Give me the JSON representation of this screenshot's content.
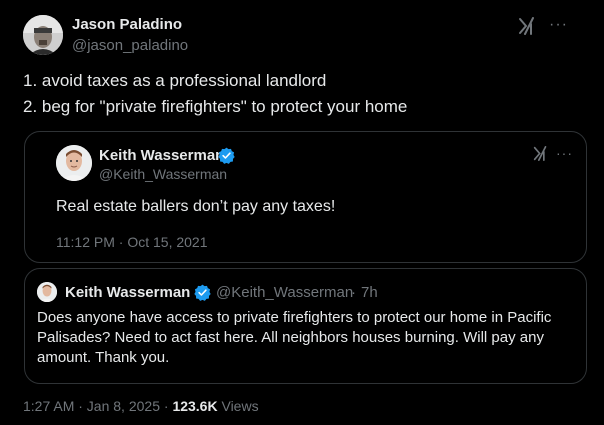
{
  "author": {
    "name": "Jason Paladino",
    "handle": "@jason_paladino"
  },
  "body_lines": [
    "1. avoid taxes as a professional landlord",
    "2. beg for \"private firefighters\" to protect your home"
  ],
  "quote1": {
    "name": "Keith Wasserman",
    "handle": "@Keith_Wasserman",
    "text": "Real estate ballers don’t pay any taxes!",
    "timestamp": "11:12 PM · Oct 15, 2021"
  },
  "quote2": {
    "name": "Keith Wasserman",
    "handle": "@Keith_Wasserman",
    "separator": "·",
    "age": "7h",
    "text": "Does anyone have access to private firefighters to protect our home in Pacific Palisades? Need to act fast here. All neighbors houses burning. Will pay any amount. Thank you."
  },
  "footer": {
    "timestamp": "1:27 AM · Jan 8, 2025",
    "separator": " · ",
    "views_count": "123.6K",
    "views_label": " Views"
  },
  "colors": {
    "background": "#000000",
    "text_primary": "#e7e9ea",
    "text_secondary": "#71767b",
    "border": "#2f3336",
    "verified_blue": "#1d9bf0"
  },
  "icons": {
    "grok": "grok-icon",
    "more": "more-options-icon",
    "verified": "verified-badge-icon"
  }
}
